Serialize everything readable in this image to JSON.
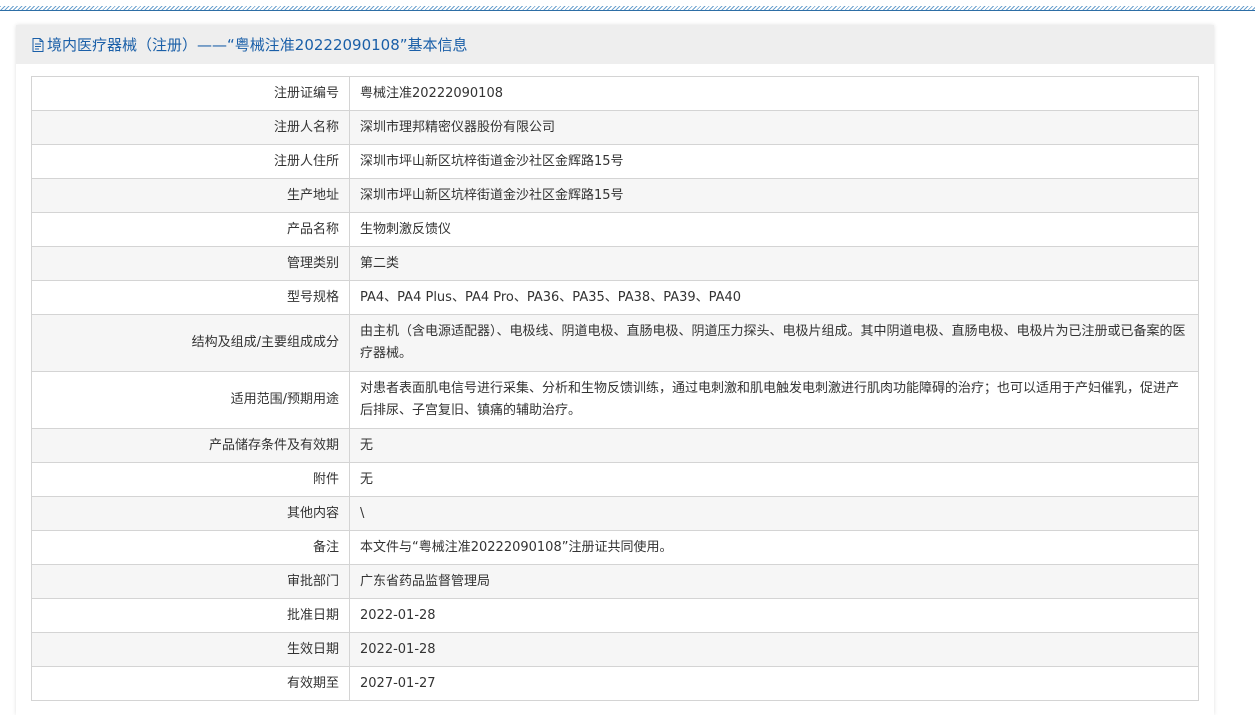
{
  "header": {
    "title": "境内医疗器械（注册）——“粤械注准20222090108”基本信息"
  },
  "rows": [
    {
      "key": "注册证编号",
      "value": "粤械注准20222090108"
    },
    {
      "key": "注册人名称",
      "value": "深圳市理邦精密仪器股份有限公司"
    },
    {
      "key": "注册人住所",
      "value": "深圳市坪山新区坑梓街道金沙社区金辉路15号"
    },
    {
      "key": "生产地址",
      "value": "深圳市坪山新区坑梓街道金沙社区金辉路15号"
    },
    {
      "key": "产品名称",
      "value": "生物刺激反馈仪"
    },
    {
      "key": "管理类别",
      "value": "第二类"
    },
    {
      "key": "型号规格",
      "value": "PA4、PA4 Plus、PA4 Pro、PA36、PA35、PA38、PA39、PA40"
    },
    {
      "key": "结构及组成/主要组成成分",
      "value": "由主机（含电源适配器）、电极线、阴道电极、直肠电极、阴道压力探头、电极片组成。其中阴道电极、直肠电极、电极片为已注册或已备案的医疗器械。"
    },
    {
      "key": "适用范围/预期用途",
      "value": "对患者表面肌电信号进行采集、分析和生物反馈训练，通过电刺激和肌电触发电刺激进行肌肉功能障碍的治疗；也可以适用于产妇催乳，促进产后排尿、子宫复旧、镇痛的辅助治疗。"
    },
    {
      "key": "产品储存条件及有效期",
      "value": "无"
    },
    {
      "key": "附件",
      "value": "无"
    },
    {
      "key": "其他内容",
      "value": "\\"
    },
    {
      "key": "备注",
      "value": "本文件与“粤械注准20222090108”注册证共同使用。"
    },
    {
      "key": "审批部门",
      "value": "广东省药品监督管理局"
    },
    {
      "key": "批准日期",
      "value": "2022-01-28"
    },
    {
      "key": "生效日期",
      "value": "2022-01-28"
    },
    {
      "key": "有效期至",
      "value": "2027-01-27"
    }
  ]
}
